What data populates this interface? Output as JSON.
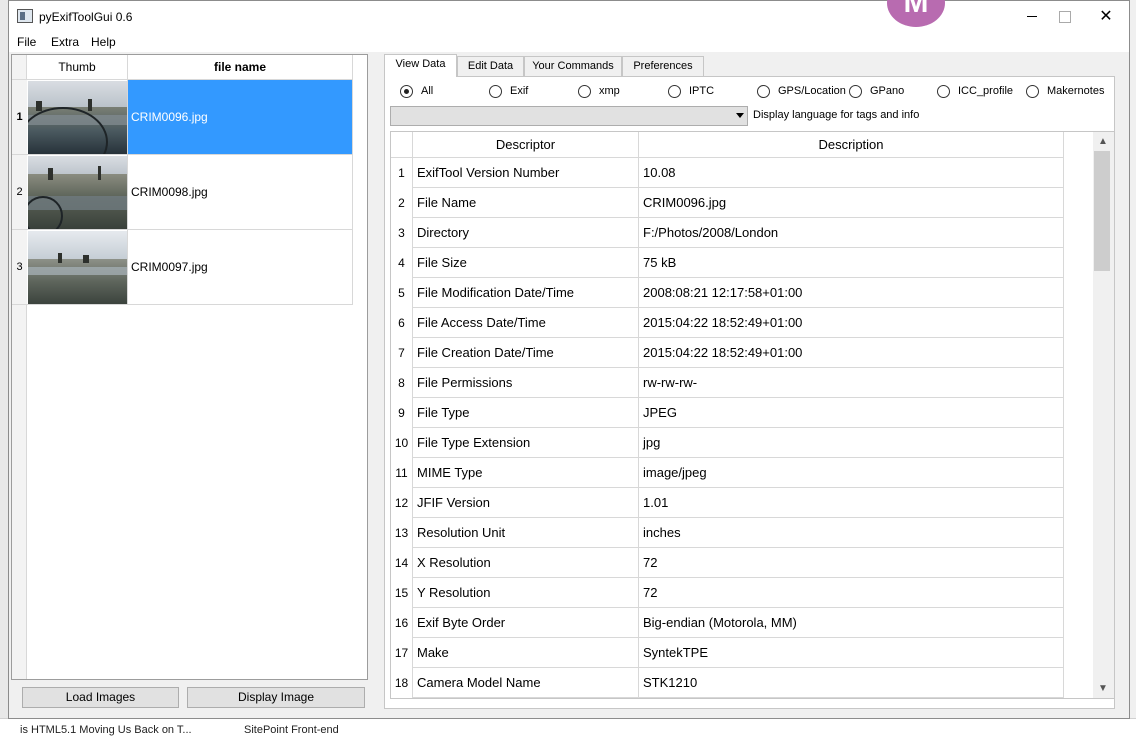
{
  "window": {
    "title": "pyExifToolGui 0.6",
    "avatar_letter": "M",
    "close_glyph": "✕"
  },
  "menu": [
    "File",
    "Extra",
    "Help"
  ],
  "images": {
    "headers": {
      "thumb": "Thumb",
      "file_name": "file name"
    },
    "rows": [
      {
        "num": "1",
        "file": "CRIM0096.jpg",
        "selected": true
      },
      {
        "num": "2",
        "file": "CRIM0098.jpg",
        "selected": false
      },
      {
        "num": "3",
        "file": "CRIM0097.jpg",
        "selected": false
      }
    ]
  },
  "buttons": {
    "load": "Load Images",
    "display": "Display Image"
  },
  "tabs": [
    "View Data",
    "Edit Data",
    "Your Commands",
    "Preferences"
  ],
  "active_tab": "View Data",
  "filters": {
    "options": [
      "All",
      "Exif",
      "xmp",
      "IPTC",
      "GPS/Location",
      "GPano",
      "ICC_profile",
      "Makernotes"
    ],
    "selected": "All"
  },
  "language": {
    "selected": "",
    "label": "Display language for tags and info"
  },
  "exif_table": {
    "headers": {
      "descriptor": "Descriptor",
      "description": "Description"
    },
    "rows": [
      {
        "n": "1",
        "k": "ExifTool Version Number",
        "v": "10.08"
      },
      {
        "n": "2",
        "k": "File Name",
        "v": "CRIM0096.jpg"
      },
      {
        "n": "3",
        "k": "Directory",
        "v": "F:/Photos/2008/London"
      },
      {
        "n": "4",
        "k": "File Size",
        "v": "75 kB"
      },
      {
        "n": "5",
        "k": "File Modification Date/Time",
        "v": "2008:08:21 12:17:58+01:00"
      },
      {
        "n": "6",
        "k": "File Access Date/Time",
        "v": "2015:04:22 18:52:49+01:00"
      },
      {
        "n": "7",
        "k": "File Creation Date/Time",
        "v": "2015:04:22 18:52:49+01:00"
      },
      {
        "n": "8",
        "k": "File Permissions",
        "v": "rw-rw-rw-"
      },
      {
        "n": "9",
        "k": "File Type",
        "v": "JPEG"
      },
      {
        "n": "10",
        "k": "File Type Extension",
        "v": "jpg"
      },
      {
        "n": "11",
        "k": "MIME Type",
        "v": "image/jpeg"
      },
      {
        "n": "12",
        "k": "JFIF Version",
        "v": "1.01"
      },
      {
        "n": "13",
        "k": "Resolution Unit",
        "v": "inches"
      },
      {
        "n": "14",
        "k": "X Resolution",
        "v": "72"
      },
      {
        "n": "15",
        "k": "Y Resolution",
        "v": "72"
      },
      {
        "n": "16",
        "k": "Exif Byte Order",
        "v": "Big-endian (Motorola, MM)"
      },
      {
        "n": "17",
        "k": "Make",
        "v": "SyntekTPE"
      },
      {
        "n": "18",
        "k": "Camera Model Name",
        "v": "STK1210"
      }
    ]
  },
  "taskbar": {
    "item1": "is HTML5.1 Moving Us Back on T...",
    "item2": "SitePoint Front-end"
  },
  "colors": {
    "selection": "#3399ff",
    "avatar": "#b86bb0"
  }
}
